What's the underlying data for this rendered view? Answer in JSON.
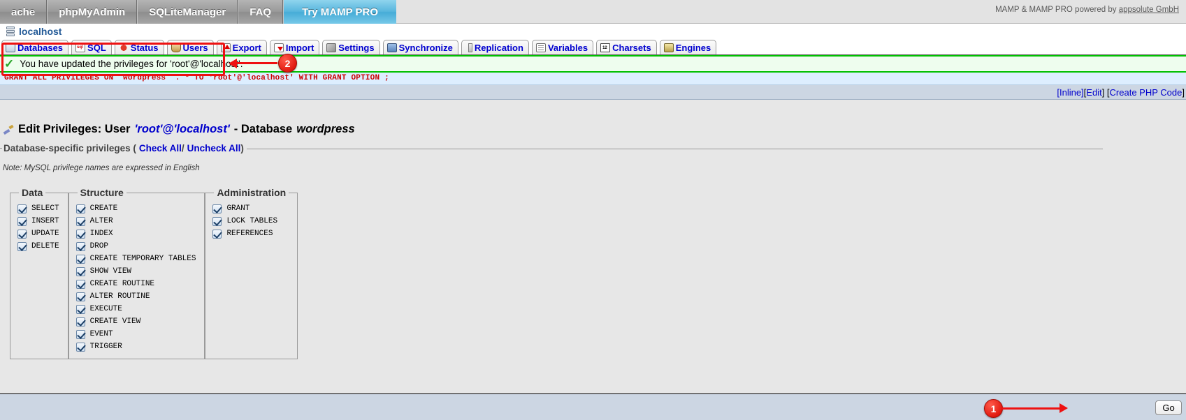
{
  "mamp": {
    "tabs": [
      "ache",
      "phpMyAdmin",
      "SQLiteManager",
      "FAQ"
    ],
    "pro_tab": "Try MAMP PRO",
    "credit_prefix": "MAMP & MAMP PRO powered by ",
    "credit_link": "appsolute GmbH"
  },
  "server": {
    "title": "localhost",
    "icon": "server-icon"
  },
  "nav": [
    {
      "label": "Databases",
      "icon": "databases-icon",
      "cls": "ic-db"
    },
    {
      "label": "SQL",
      "icon": "sql-icon",
      "cls": "ic-sql"
    },
    {
      "label": "Status",
      "icon": "status-icon",
      "cls": "ic-status"
    },
    {
      "label": "Users",
      "icon": "users-icon",
      "cls": "ic-users"
    },
    {
      "label": "Export",
      "icon": "export-icon",
      "cls": "ic-export"
    },
    {
      "label": "Import",
      "icon": "import-icon",
      "cls": "ic-import"
    },
    {
      "label": "Settings",
      "icon": "settings-icon",
      "cls": "ic-settings"
    },
    {
      "label": "Synchronize",
      "icon": "synchronize-icon",
      "cls": "ic-sync"
    },
    {
      "label": "Replication",
      "icon": "replication-icon",
      "cls": "ic-repl"
    },
    {
      "label": "Variables",
      "icon": "variables-icon",
      "cls": "ic-vars"
    },
    {
      "label": "Charsets",
      "icon": "charsets-icon",
      "cls": "ic-charsets"
    },
    {
      "label": "Engines",
      "icon": "engines-icon",
      "cls": "ic-engines"
    }
  ],
  "result": {
    "success_message": "You have updated the privileges for 'root'@'localhost'.",
    "success_icon": "green-check-icon",
    "query": "GRANT ALL PRIVILEGES ON `wordpress` . * TO 'root'@'localhost' WITH GRANT OPTION ;",
    "links": {
      "inline": "[Inline]",
      "edit_open": "[ ",
      "edit": "Edit",
      "edit_close": " ] [ ",
      "create_php": "Create PHP Code",
      "tail": " ]"
    }
  },
  "page": {
    "title_prefix": "Edit Privileges: User ",
    "title_user": "'root'@'localhost'",
    "title_mid": " - Database ",
    "title_db": "wordpress",
    "title_icon": "edit-privileges-icon"
  },
  "privileges_section": {
    "legend_text": "Database-specific privileges (",
    "check_all": "Check All",
    "separator": " / ",
    "uncheck_all": "Uncheck All",
    "legend_close": ")",
    "note": "Note: MySQL privilege names are expressed in English"
  },
  "groups": [
    {
      "legend": "Data",
      "items": [
        {
          "label": "SELECT",
          "checked": true
        },
        {
          "label": "INSERT",
          "checked": true
        },
        {
          "label": "UPDATE",
          "checked": true
        },
        {
          "label": "DELETE",
          "checked": true
        }
      ]
    },
    {
      "legend": "Structure",
      "items": [
        {
          "label": "CREATE",
          "checked": true
        },
        {
          "label": "ALTER",
          "checked": true
        },
        {
          "label": "INDEX",
          "checked": true
        },
        {
          "label": "DROP",
          "checked": true
        },
        {
          "label": "CREATE TEMPORARY TABLES",
          "checked": true
        },
        {
          "label": "SHOW VIEW",
          "checked": true
        },
        {
          "label": "CREATE ROUTINE",
          "checked": true
        },
        {
          "label": "ALTER ROUTINE",
          "checked": true
        },
        {
          "label": "EXECUTE",
          "checked": true
        },
        {
          "label": "CREATE VIEW",
          "checked": true
        },
        {
          "label": "EVENT",
          "checked": true
        },
        {
          "label": "TRIGGER",
          "checked": true
        }
      ]
    },
    {
      "legend": "Administration",
      "items": [
        {
          "label": "GRANT",
          "checked": true
        },
        {
          "label": "LOCK TABLES",
          "checked": true
        },
        {
          "label": "REFERENCES",
          "checked": true
        }
      ]
    }
  ],
  "footer": {
    "go_label": "Go"
  },
  "annotations": [
    {
      "id": "1",
      "number": "1"
    },
    {
      "id": "2",
      "number": "2"
    }
  ],
  "colors": {
    "accent_red": "#ee1111",
    "link_blue": "#0000cc",
    "success_green": "#00c000",
    "pro_blue": "#58b6dd"
  }
}
